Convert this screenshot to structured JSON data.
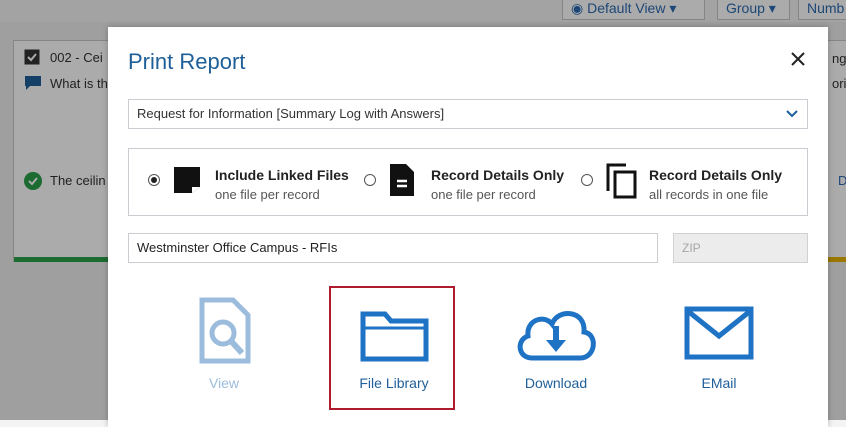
{
  "background": {
    "toolbar": {
      "view_label": "Default View",
      "group_label": "Group",
      "number_label": "Numb"
    },
    "card": {
      "title": "002 - Cei",
      "question": "What is th",
      "answer": "The ceilin",
      "side_text_1": "ng",
      "side_text_2": "oriz",
      "side_text_3": "D"
    }
  },
  "modal": {
    "title": "Print Report",
    "report_select": {
      "value": "Request for Information [Summary Log with Answers]"
    },
    "options": [
      {
        "title": "Include Linked Files",
        "subtitle": "one file per record",
        "checked": true,
        "icon": "file-linked-icon"
      },
      {
        "title": "Record Details Only",
        "subtitle": "one file per record",
        "checked": false,
        "icon": "document-icon"
      },
      {
        "title": "Record Details Only",
        "subtitle": "all records in one file",
        "checked": false,
        "icon": "copy-icon"
      }
    ],
    "file_name": "Westminster Office Campus - RFIs",
    "zip_placeholder": "ZIP",
    "actions": [
      {
        "label": "View",
        "enabled": false,
        "icon": "view-document-icon"
      },
      {
        "label": "File Library",
        "enabled": true,
        "icon": "folder-icon",
        "highlighted": true
      },
      {
        "label": "Download",
        "enabled": true,
        "icon": "cloud-download-icon"
      },
      {
        "label": "EMail",
        "enabled": true,
        "icon": "envelope-icon"
      }
    ],
    "colors": {
      "accent": "#1f5f99",
      "icon_blue": "#1f73c4",
      "disabled": "#9bbcdc",
      "highlight": "#b01c2e"
    }
  }
}
